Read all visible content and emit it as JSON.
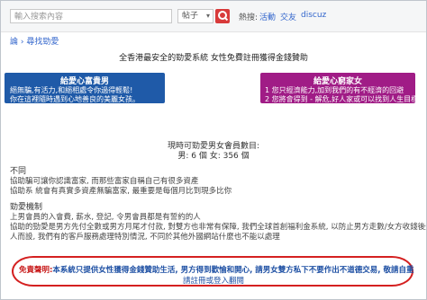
{
  "search": {
    "placeholder": "輸入搜索內容",
    "scope": "帖子"
  },
  "hot": {
    "label": "熱搜:",
    "links": [
      "活動",
      "交友",
      "discuz"
    ]
  },
  "breadcrumb": "論 › 尋找勁愛",
  "subtitle": "全香港最安全的勁愛系統  女性免費註冊獲得金錢贊助",
  "panels": {
    "left": {
      "title": "給愛心富貴男",
      "lines": [
        "絕無騙,有活力,和絕相處令你過得輕鬆!",
        "你在這裡隨時遇到心地善良的美麗女孩。"
      ]
    },
    "right": {
      "title": "給愛心窮家女",
      "lines": [
        "1  您只經濟能力,加到我們的有不經濟的回避",
        "2  您將會得到 - 解危,好人家或可以找到人生目標"
      ]
    }
  },
  "stats": {
    "label": "現時可勁愛男女會員數目:",
    "counts": "男: 6 個 女: 356 個"
  },
  "sections": {
    "s1_title": "不同",
    "s1_lines": [
      "協助騙可讓你認識富家, 而那些富家自稱自己有很多資產",
      "協助系 統會有真實多資產無騙富家, 最重要是每個月比到現多比你"
    ],
    "s2_title": "勁愛機制",
    "s2_lines": [
      "上男會員的入會費, 薪水, 登記, 令男會員都是有誓約的人",
      "協助的勁愛是男方先付全數或男方月尾才付款, 對雙方也非常有保障, 我們全球首創福利金系統, 以防止男方走數/女方收錢後失聯等問題",
      "人而設, 我們有的客戶服務處理特別情況, 不同於其他外國網站什麼也不能以處理"
    ]
  },
  "notice": {
    "lead": "免責聲明:",
    "line1": "本系統只提供女性獲得金錢贊助生活, 男方得到歡愉和開心, 請男女雙方私下不要作出不道德交易, 敬請自重",
    "line2": "請註冊或登入翻閱"
  }
}
